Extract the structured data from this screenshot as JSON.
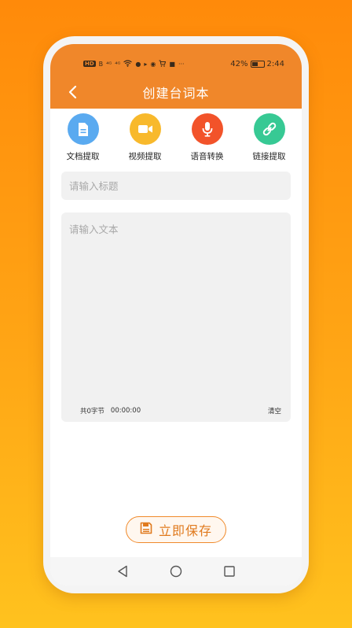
{
  "status_bar": {
    "left_glyphs": [
      "HD",
      "B",
      "⁴ᴳ",
      "⁴ᴳ",
      "wifi",
      "●",
      "▸",
      "◉",
      "cart",
      "■",
      "···"
    ],
    "battery_percent": "42%",
    "time": "2:44"
  },
  "header": {
    "title": "创建台词本"
  },
  "tools": [
    {
      "label": "文档提取",
      "icon": "document-icon",
      "color": "#5aaaf0"
    },
    {
      "label": "视频提取",
      "icon": "video-camera-icon",
      "color": "#f8b92c"
    },
    {
      "label": "语音转换",
      "icon": "microphone-icon",
      "color": "#f2532a"
    },
    {
      "label": "链接提取",
      "icon": "link-icon",
      "color": "#37c994"
    }
  ],
  "form": {
    "title_placeholder": "请输入标题",
    "title_value": "",
    "text_placeholder": "请输入文本",
    "text_value": "",
    "char_count": "共0字节",
    "duration": "00:00:00",
    "clear_label": "清空"
  },
  "save_button": {
    "label": "立即保存",
    "icon": "floppy-disk-icon"
  },
  "nav_bar": {
    "back": "back-triangle-icon",
    "home": "home-circle-icon",
    "recents": "recents-square-icon"
  },
  "colors": {
    "accent": "#f0872a",
    "background_top": "#ff8a0a",
    "background_bottom": "#ffc21e"
  }
}
